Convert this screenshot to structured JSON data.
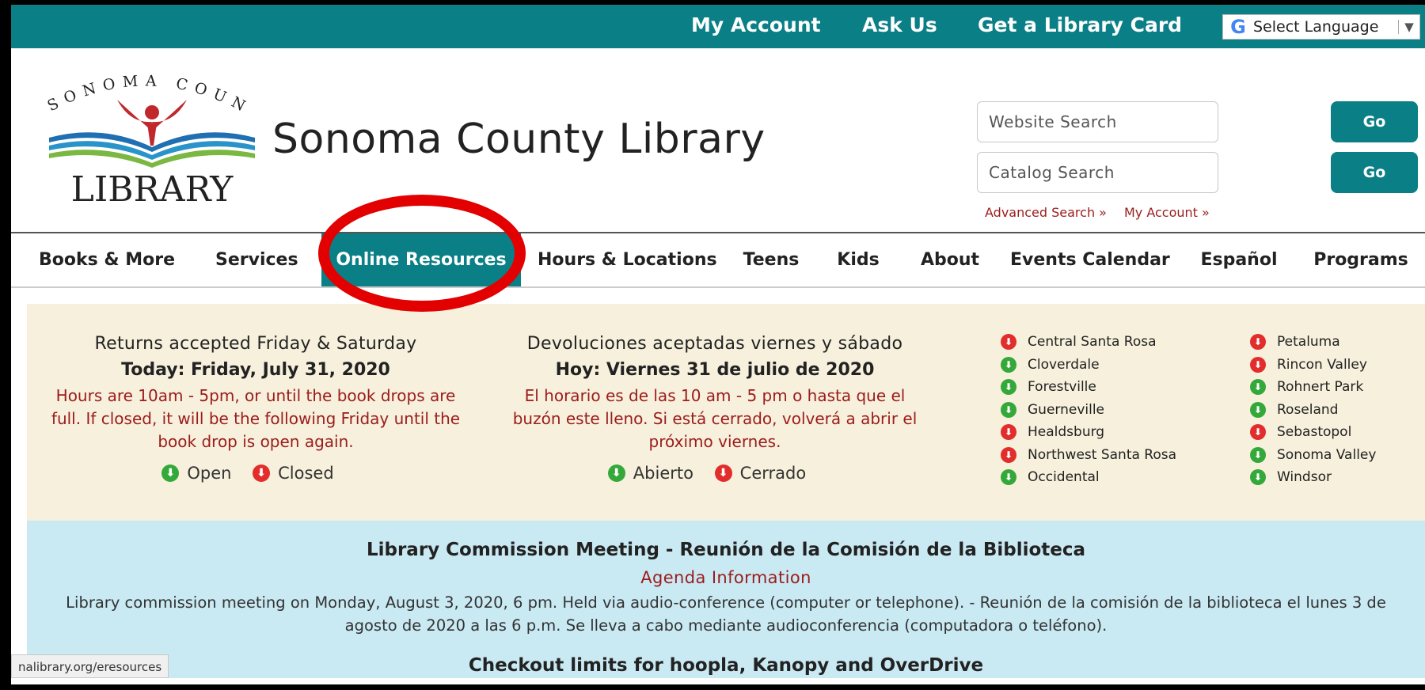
{
  "topbar": {
    "links": [
      "My Account",
      "Ask Us",
      "Get a Library Card"
    ],
    "language_select": {
      "value": "Select Language",
      "logo": "G"
    }
  },
  "header": {
    "logo": {
      "top_text": "SONOMA COUNTY",
      "bottom_text": "LIBRARY"
    },
    "title": "Sonoma County Library",
    "website_search_placeholder": "Website Search",
    "catalog_search_placeholder": "Catalog Search",
    "go_label": "Go",
    "advanced_search": "Advanced Search »",
    "my_account": "My Account »"
  },
  "nav": {
    "items": [
      "Books & More",
      "Services",
      "Online Resources",
      "Hours & Locations",
      "Teens",
      "Kids",
      "About",
      "Events Calendar",
      "Español",
      "Programs"
    ],
    "active": "Online Resources"
  },
  "notice": {
    "english": {
      "title": "Returns accepted Friday & Saturday",
      "today": "Today: Friday, July 31, 2020",
      "hours": "Hours are 10am - 5pm, or until the book drops are full. If closed, it will be the following Friday until the book drop is open again.",
      "open_label": "Open",
      "closed_label": "Closed"
    },
    "spanish": {
      "title": "Devoluciones aceptadas viernes y sábado",
      "today": "Hoy: Viernes 31 de julio de 2020",
      "hours": "El horario es de las 10 am - 5 pm o hasta que el buzón este lleno. Si está cerrado, volverá a abrir el próximo viernes.",
      "open_label": "Abierto",
      "closed_label": "Cerrado"
    },
    "branches_col1": [
      {
        "name": "Central Santa Rosa",
        "status": "closed"
      },
      {
        "name": "Cloverdale",
        "status": "open"
      },
      {
        "name": "Forestville",
        "status": "open"
      },
      {
        "name": "Guerneville",
        "status": "open"
      },
      {
        "name": "Healdsburg",
        "status": "closed"
      },
      {
        "name": "Northwest Santa Rosa",
        "status": "closed"
      },
      {
        "name": "Occidental",
        "status": "open"
      }
    ],
    "branches_col2": [
      {
        "name": "Petaluma",
        "status": "closed"
      },
      {
        "name": "Rincon Valley",
        "status": "closed"
      },
      {
        "name": "Rohnert Park",
        "status": "open"
      },
      {
        "name": "Roseland",
        "status": "open"
      },
      {
        "name": "Sebastopol",
        "status": "closed"
      },
      {
        "name": "Sonoma Valley",
        "status": "open"
      },
      {
        "name": "Windsor",
        "status": "open"
      }
    ]
  },
  "commission": {
    "title": "Library Commission Meeting - Reunión de la Comisión de la Biblioteca",
    "link": "Agenda Information",
    "body": "Library commission meeting on Monday, August 3, 2020, 6 pm. Held via audio-conference (computer or telephone). - Reunión de la comisión de la biblioteca el lunes 3 de agosto de 2020 a las 6 p.m. Se lleva a cabo mediante audioconferencia (computadora o teléfono).",
    "next_title": "Checkout limits for hoopla, Kanopy and OverDrive"
  },
  "status_url": "nalibrary.org/eresources",
  "colors": {
    "teal": "#0a7f86",
    "red_text": "#9b1c1c",
    "open": "#35a83a",
    "closed": "#e32c2c",
    "highlight": "#e30000"
  }
}
